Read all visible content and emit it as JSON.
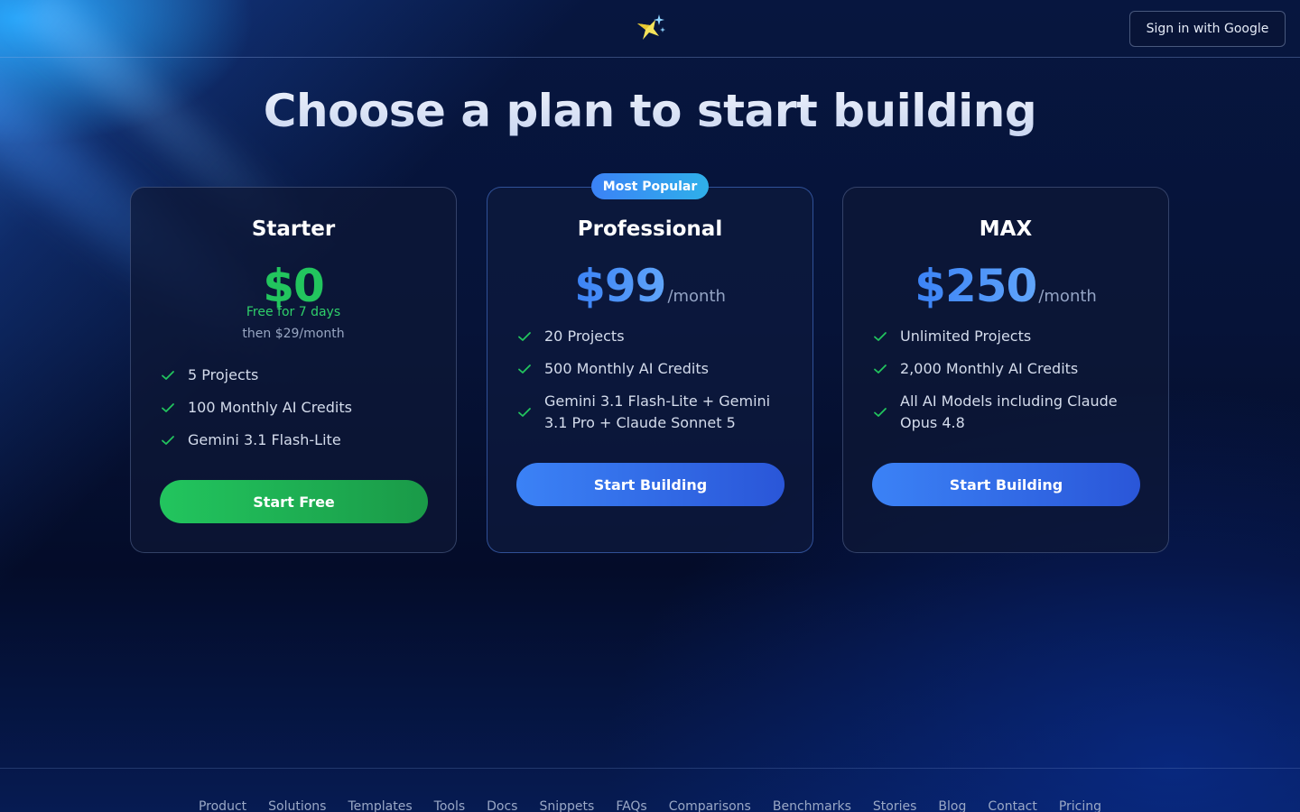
{
  "header": {
    "sign_in_label": "Sign in with Google"
  },
  "hero": {
    "title": "Choose a plan to start building"
  },
  "plans": [
    {
      "name": "Starter",
      "price": "$0",
      "trial": "Free for 7 days",
      "then": "then $29/month",
      "features": [
        "5 Projects",
        "100 Monthly AI Credits",
        "Gemini 3.1 Flash-Lite"
      ],
      "cta": "Start Free"
    },
    {
      "badge": "Most Popular",
      "name": "Professional",
      "price": "$99",
      "period": "/month",
      "features": [
        "20 Projects",
        "500 Monthly AI Credits",
        "Gemini 3.1 Flash-Lite + Gemini 3.1 Pro + Claude Sonnet 5"
      ],
      "cta": "Start Building"
    },
    {
      "name": "MAX",
      "price": "$250",
      "period": "/month",
      "features": [
        "Unlimited Projects",
        "2,000 Monthly AI Credits",
        "All AI Models including Claude Opus 4.8"
      ],
      "cta": "Start Building"
    }
  ],
  "footer": {
    "links": [
      "Product",
      "Solutions",
      "Templates",
      "Tools",
      "Docs",
      "Snippets",
      "FAQs",
      "Comparisons",
      "Benchmarks",
      "Stories",
      "Blog",
      "Contact",
      "Pricing"
    ]
  },
  "colors": {
    "accent_blue": "#3b82f6",
    "accent_green": "#22c55e",
    "background": "#06102e"
  },
  "icons": [
    "sparkle-star-logo-icon",
    "check-icon"
  ]
}
